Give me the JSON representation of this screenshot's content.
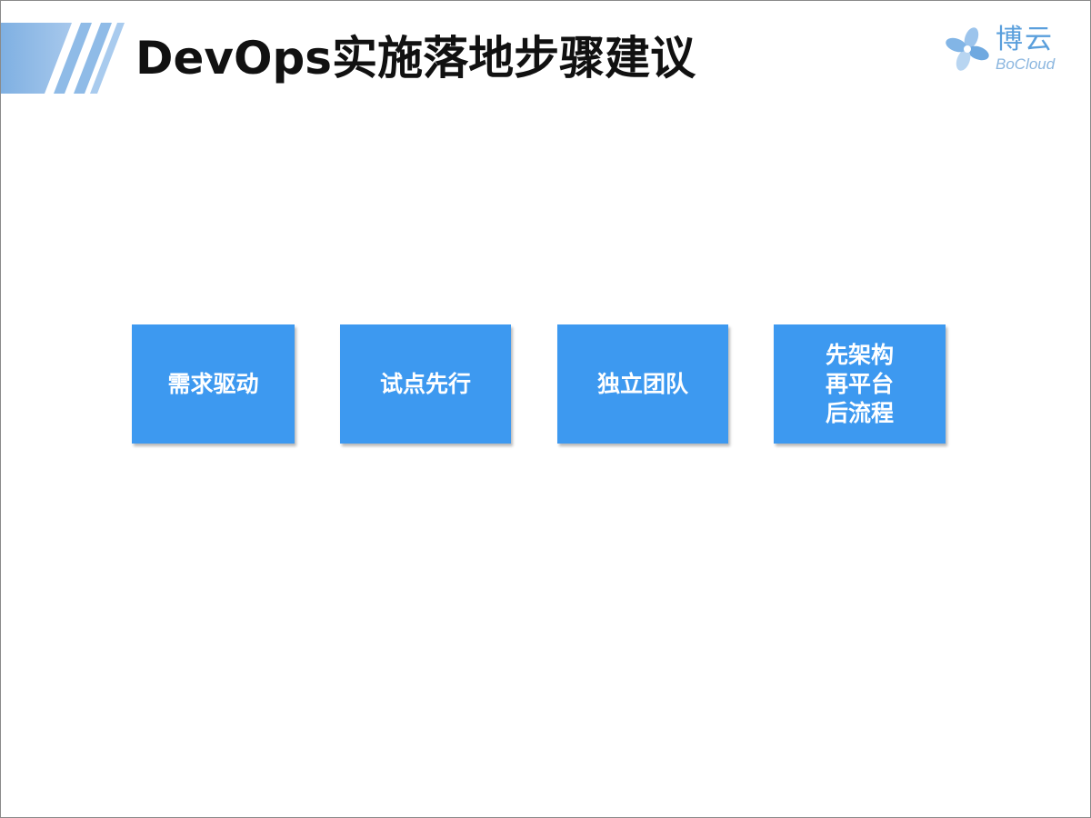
{
  "slide": {
    "title": "DevOps实施落地步骤建议",
    "logo": {
      "chinese_name": "博云",
      "english_name": "BoCloud"
    },
    "steps": [
      {
        "label": "需求驱动"
      },
      {
        "label": "试点先行"
      },
      {
        "label": "独立团队"
      },
      {
        "label": "先架构\n再平台\n后流程"
      }
    ]
  },
  "colors": {
    "step_box": "#3d99f0",
    "step_text": "#ffffff",
    "title_text": "#111111",
    "header_stripe": "#5b9bd5",
    "logo_primary": "#5a9fdc",
    "logo_secondary": "#8bb6df"
  },
  "icons": {
    "header_decoration": "diagonal-stripes",
    "logo": "bocloud-flower-icon"
  }
}
